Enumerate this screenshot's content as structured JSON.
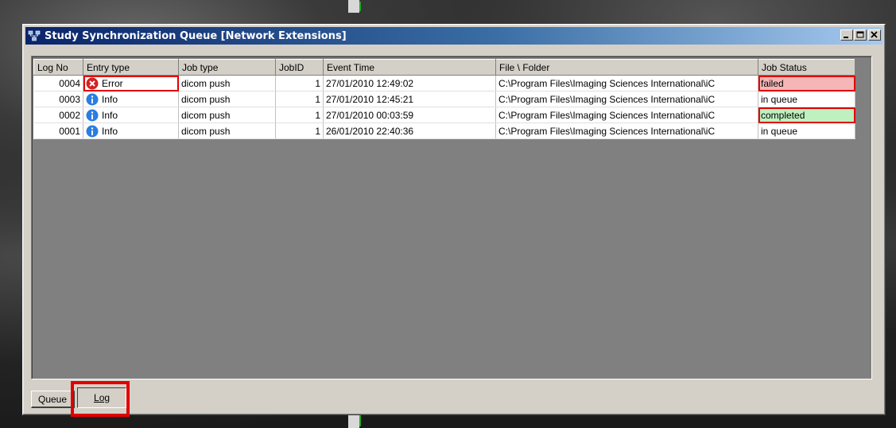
{
  "window": {
    "title": "Study Synchronization Queue [Network Extensions]"
  },
  "table": {
    "columns": [
      "Log No",
      "Entry type",
      "Job type",
      "JobID",
      "Event Time",
      "File \\ Folder",
      "Job Status"
    ],
    "rows": [
      {
        "log_no": "0004",
        "entry_type": "Error",
        "entry_icon": "error-icon",
        "job_type": "dicom push",
        "job_id": "1",
        "event_time": "27/01/2010 12:49:02",
        "file_folder": "C:\\Program Files\\Imaging Sciences International\\iC",
        "job_status": "failed"
      },
      {
        "log_no": "0003",
        "entry_type": "Info",
        "entry_icon": "info-icon",
        "job_type": "dicom push",
        "job_id": "1",
        "event_time": "27/01/2010 12:45:21",
        "file_folder": "C:\\Program Files\\Imaging Sciences International\\iC",
        "job_status": "in queue"
      },
      {
        "log_no": "0002",
        "entry_type": "Info",
        "entry_icon": "info-icon",
        "job_type": "dicom push",
        "job_id": "1",
        "event_time": "27/01/2010 00:03:59",
        "file_folder": "C:\\Program Files\\Imaging Sciences International\\iC",
        "job_status": "completed"
      },
      {
        "log_no": "0001",
        "entry_type": "Info",
        "entry_icon": "info-icon",
        "job_type": "dicom push",
        "job_id": "1",
        "event_time": "26/01/2010 22:40:36",
        "file_folder": "C:\\Program Files\\Imaging Sciences International\\iC",
        "job_status": "in queue"
      }
    ]
  },
  "tabs": {
    "queue": "Queue",
    "log": "Log"
  },
  "colors": {
    "failed": "#f4b6b6",
    "completed": "#bff0bf",
    "highlight": "#e00000"
  }
}
